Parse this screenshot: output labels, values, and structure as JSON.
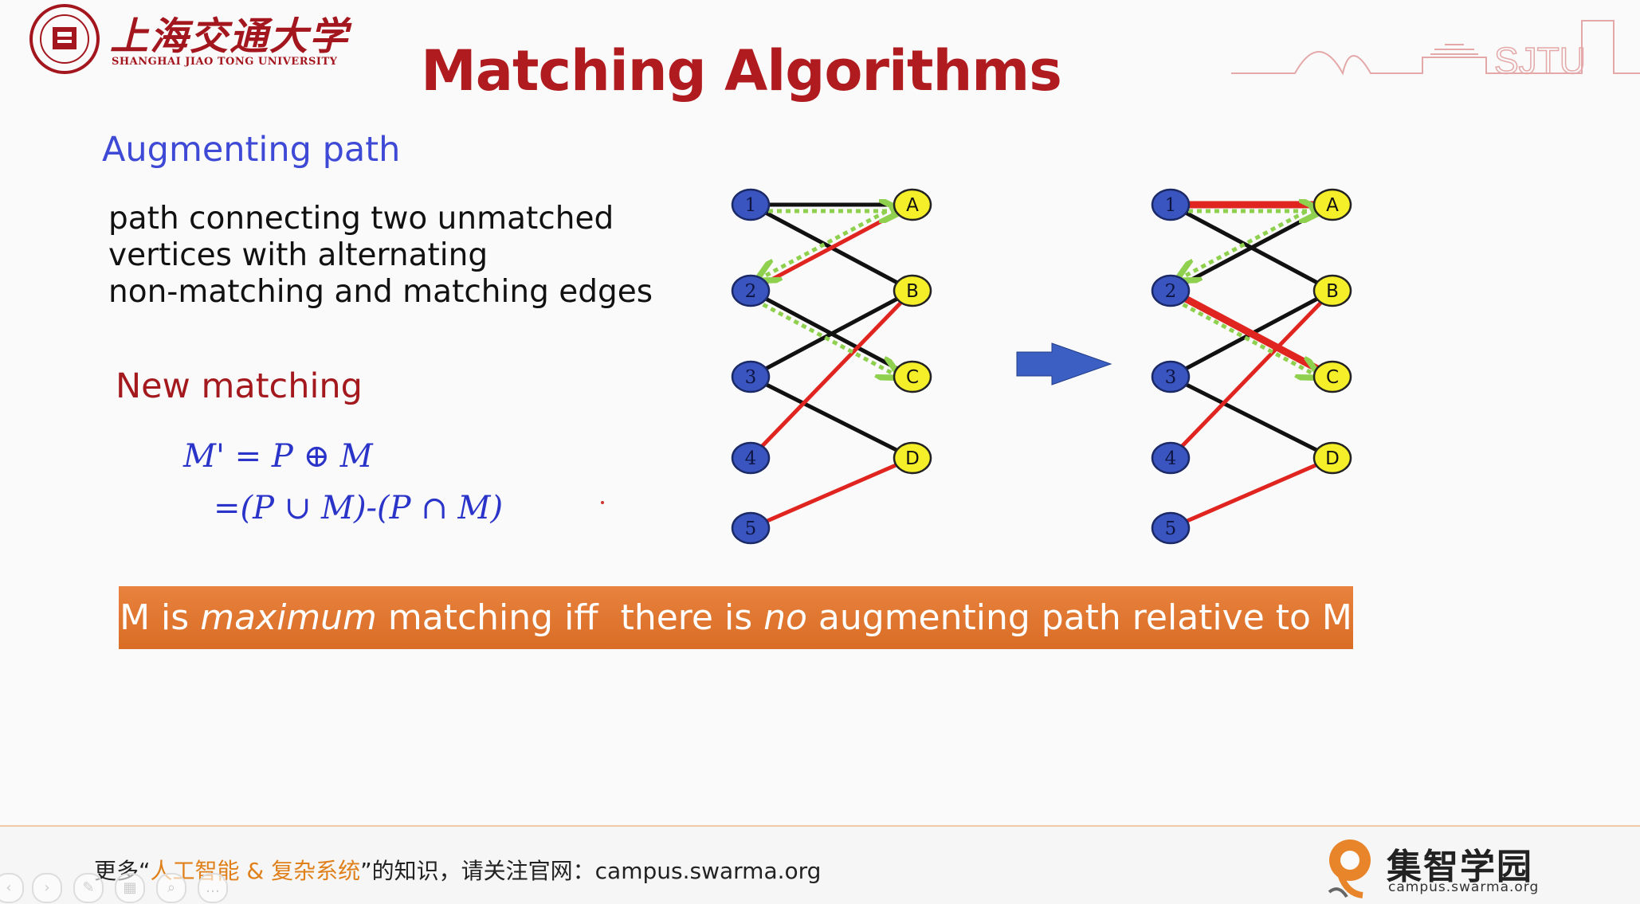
{
  "header": {
    "university_cn": "上海交通大学",
    "university_en": "SHANGHAI JIAO TONG UNIVERSITY",
    "slide_title": "Matching Algorithms",
    "deco_text": "SJTU"
  },
  "augmenting": {
    "heading": "Augmenting path",
    "lines": [
      "path connecting two unmatched",
      "vertices  with alternating",
      "non-matching and matching edges"
    ]
  },
  "new_matching": {
    "heading": "New matching",
    "formula_1": "M' = P ⊕ M",
    "formula_2": "=(P ∪ M)-(P ∩ M)"
  },
  "graph": {
    "left_nodes": [
      "1",
      "2",
      "3",
      "4",
      "5"
    ],
    "right_nodes": [
      "A",
      "B",
      "C",
      "D"
    ],
    "colors": {
      "left_node": "#3a55c0",
      "right_node": "#f5ef2a",
      "matching_edge": "#e02520",
      "non_matching_edge": "#111111",
      "path_edge": "#8fd14f",
      "arrow": "#3b5fc2"
    },
    "before": {
      "non_matching": [
        [
          "1",
          "A"
        ],
        [
          "1",
          "B"
        ],
        [
          "2",
          "C"
        ],
        [
          "3",
          "B"
        ],
        [
          "3",
          "D"
        ]
      ],
      "matching": [
        [
          "2",
          "A"
        ],
        [
          "4",
          "B"
        ],
        [
          "5",
          "D"
        ]
      ],
      "path": [
        [
          "1",
          "A"
        ],
        [
          "A",
          "2"
        ],
        [
          "2",
          "C"
        ]
      ]
    },
    "after": {
      "non_matching": [
        [
          "1",
          "B"
        ],
        [
          "2",
          "A"
        ],
        [
          "3",
          "B"
        ],
        [
          "3",
          "D"
        ]
      ],
      "matching": [
        [
          "1",
          "A"
        ],
        [
          "2",
          "C"
        ],
        [
          "4",
          "B"
        ],
        [
          "5",
          "D"
        ]
      ],
      "path": [
        [
          "1",
          "A"
        ],
        [
          "A",
          "2"
        ],
        [
          "2",
          "C"
        ]
      ]
    }
  },
  "banner": {
    "p1": "M is ",
    "p2": "maximum",
    "p3": " matching iff  there is ",
    "p4": "no",
    "p5": " augmenting path relative to M"
  },
  "footer": {
    "prefix": "更多“",
    "highlight": "人工智能 & 复杂系统",
    "suffix": "”的知识，请关注官网：campus.swarma.org",
    "brand_name": "集智学园",
    "brand_url": "campus.swarma.org"
  }
}
